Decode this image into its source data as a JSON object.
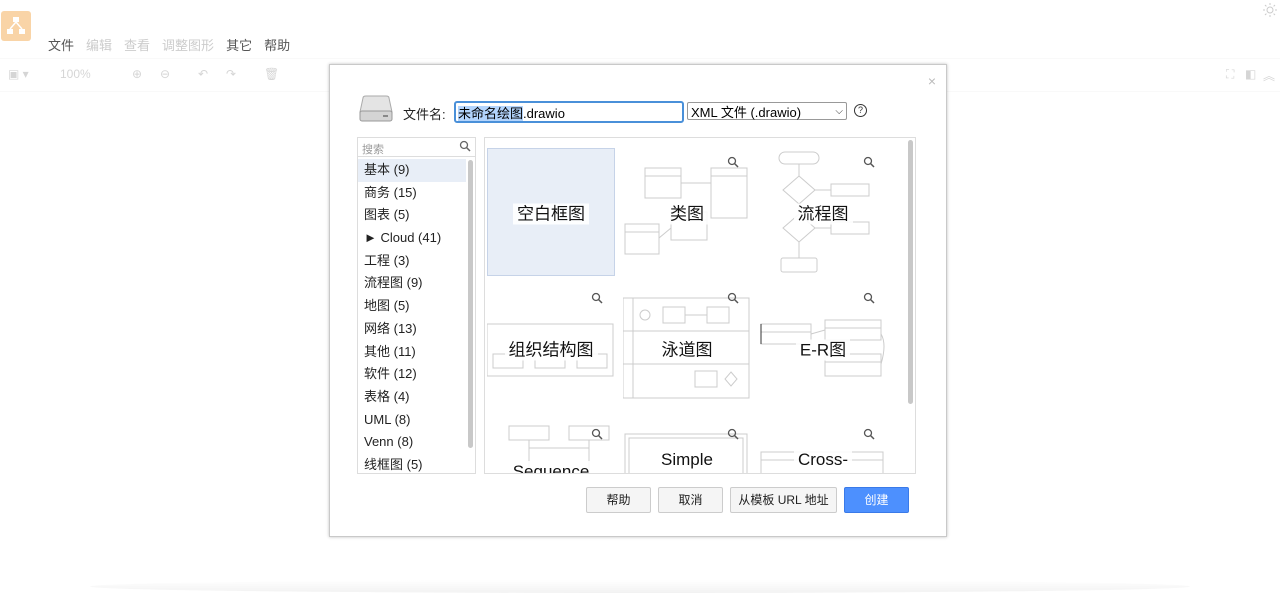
{
  "app": {
    "menu": [
      {
        "label": "文件",
        "dim": false
      },
      {
        "label": "编辑",
        "dim": true
      },
      {
        "label": "查看",
        "dim": true
      },
      {
        "label": "调整图形",
        "dim": true
      },
      {
        "label": "其它",
        "dim": false
      },
      {
        "label": "帮助",
        "dim": false
      }
    ],
    "zoom": "100%"
  },
  "dialog": {
    "filename_label": "文件名:",
    "filename_value_selected": "未命名绘图",
    "filename_value_rest": ".drawio",
    "format_value": "XML 文件 (.drawio)",
    "help_glyph": "?",
    "close_glyph": "×",
    "search_placeholder": "搜索",
    "categories": [
      {
        "label": "基本 (9)"
      },
      {
        "label": "商务 (15)"
      },
      {
        "label": "图表 (5)"
      },
      {
        "label": "► Cloud (41)"
      },
      {
        "label": "工程 (3)"
      },
      {
        "label": "流程图 (9)"
      },
      {
        "label": "地图 (5)"
      },
      {
        "label": "网络 (13)"
      },
      {
        "label": "其他 (11)"
      },
      {
        "label": "软件 (12)"
      },
      {
        "label": "表格 (4)"
      },
      {
        "label": "UML (8)"
      },
      {
        "label": "Venn (8)"
      },
      {
        "label": "线框图 (5)"
      }
    ],
    "templates": [
      {
        "label": "空白框图"
      },
      {
        "label": "类图"
      },
      {
        "label": "流程图"
      },
      {
        "label": "组织结构图"
      },
      {
        "label": "泳道图"
      },
      {
        "label": "E-R图"
      },
      {
        "label": "Sequence"
      },
      {
        "label": "Simple"
      },
      {
        "label": "Cross-"
      }
    ],
    "buttons": {
      "help": "帮助",
      "cancel": "取消",
      "from_url": "从模板 URL 地址",
      "create": "创建"
    },
    "accent_color": "#4d90fe"
  }
}
